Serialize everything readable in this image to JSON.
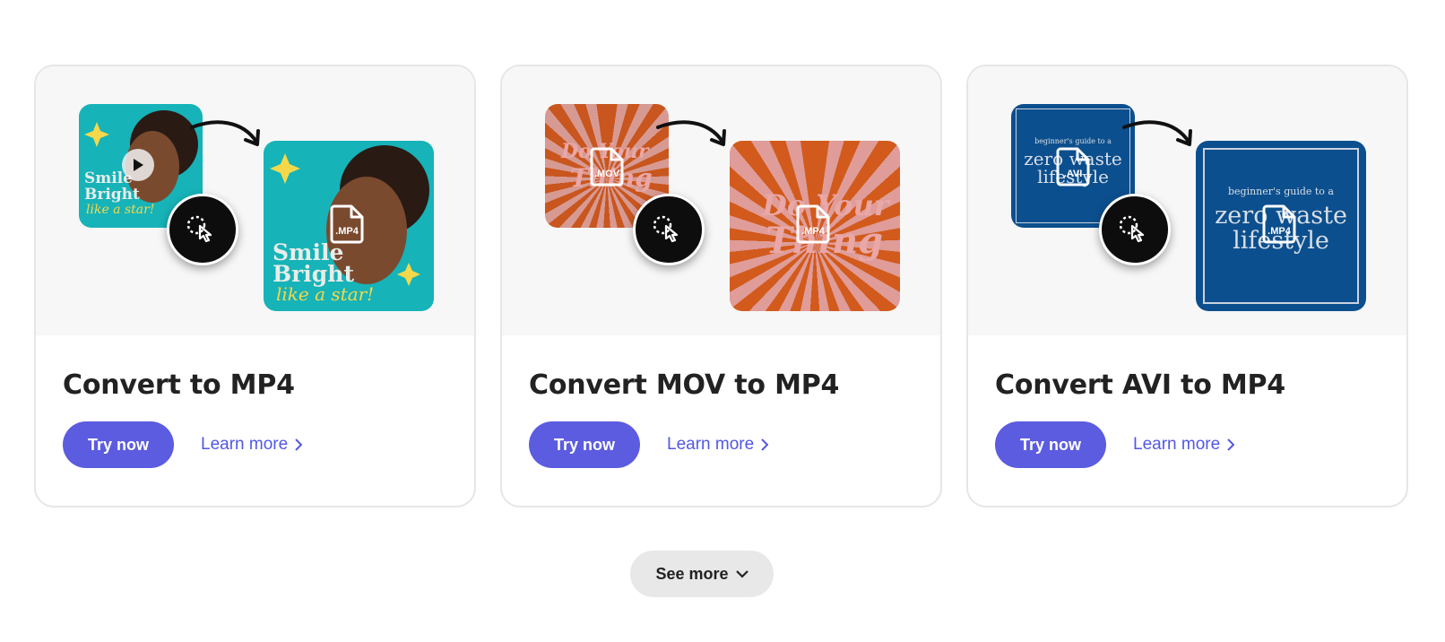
{
  "cards": [
    {
      "title": "Convert to MP4",
      "try_label": "Try now",
      "learn_label": "Learn more",
      "target_format": ".MP4",
      "thumb_text": [
        "Smile",
        "Bright",
        "like a star!"
      ],
      "colors": {
        "bg": "#16b3b8",
        "accent": "#f5d84a"
      }
    },
    {
      "title": "Convert MOV to MP4",
      "try_label": "Try now",
      "learn_label": "Learn more",
      "source_format": ".MOV",
      "target_format": ".MP4",
      "thumb_text": [
        "Do Your",
        "Thing"
      ],
      "colors": {
        "bg": "#d9591e",
        "accent": "#e9a7a7"
      }
    },
    {
      "title": "Convert AVI to MP4",
      "try_label": "Try now",
      "learn_label": "Learn more",
      "source_format": ".AVI",
      "target_format": ".MP4",
      "thumb_text": [
        "beginner's guide to a",
        "zero waste",
        "lifestyle"
      ],
      "colors": {
        "bg": "#0c4f8e",
        "accent": "#d9dfe6"
      }
    }
  ],
  "see_more": {
    "label": "See more"
  },
  "icons": [
    "play-icon",
    "convert-icon",
    "file-icon",
    "arrow-icon",
    "chevron-right-icon",
    "chevron-down-icon"
  ],
  "colors": {
    "primary": "#5c5ce0",
    "link": "#5258e4",
    "card_border": "#e6e6e6"
  }
}
